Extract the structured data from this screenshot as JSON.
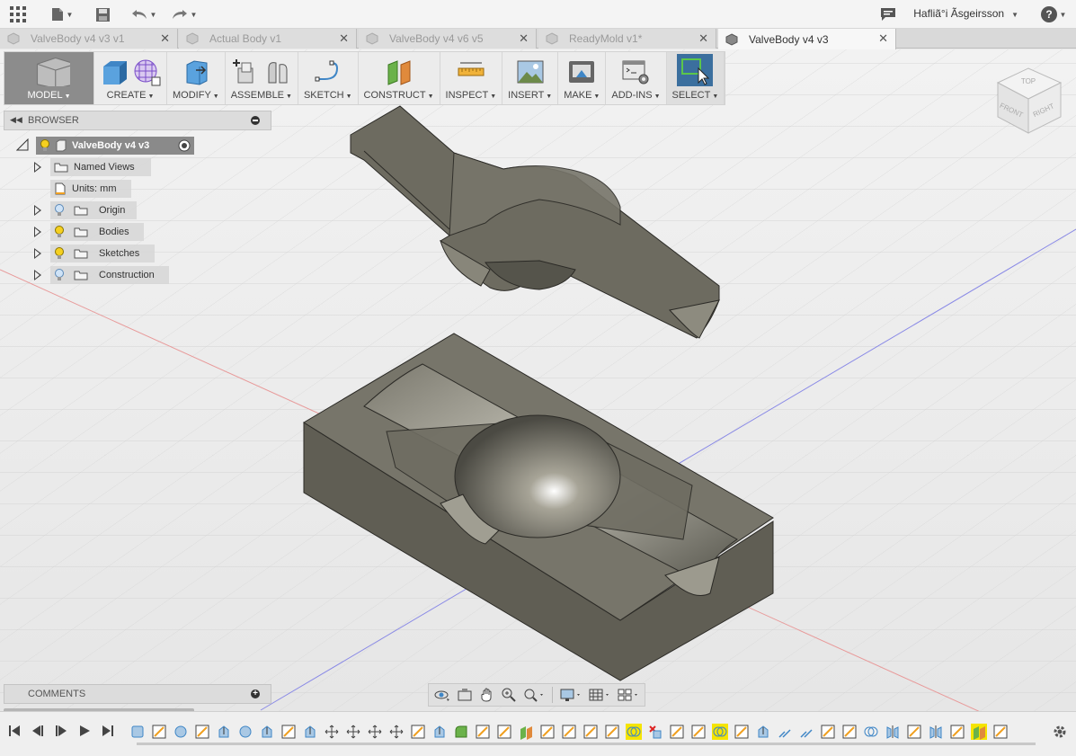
{
  "app": {
    "user_name": "Hafliã°i Ãsgeirsson",
    "icons": [
      "apps-grid-icon",
      "file-icon",
      "save-icon",
      "undo-icon",
      "redo-icon",
      "comment-icon",
      "help-icon"
    ]
  },
  "tabs": [
    {
      "label": "ValveBody v4 v3 v1",
      "active": false
    },
    {
      "label": "Actual Body v1",
      "active": false
    },
    {
      "label": "ValveBody v4 v6 v5",
      "active": false
    },
    {
      "label": "ReadyMold v1*",
      "active": false
    },
    {
      "label": "ValveBody v4 v3",
      "active": true
    }
  ],
  "toolbar": {
    "groups": [
      {
        "label": "MODEL",
        "icons": [
          "model-workspace-icon"
        ]
      },
      {
        "label": "CREATE",
        "icons": [
          "box-icon",
          "form-icon"
        ]
      },
      {
        "label": "MODIFY",
        "icons": [
          "press-pull-icon"
        ]
      },
      {
        "label": "ASSEMBLE",
        "icons": [
          "new-component-icon",
          "joint-icon"
        ]
      },
      {
        "label": "SKETCH",
        "icons": [
          "sketch-icon"
        ]
      },
      {
        "label": "CONSTRUCT",
        "icons": [
          "plane-icon"
        ]
      },
      {
        "label": "INSPECT",
        "icons": [
          "measure-icon"
        ]
      },
      {
        "label": "INSERT",
        "icons": [
          "insert-image-icon"
        ]
      },
      {
        "label": "MAKE",
        "icons": [
          "make-3d-print-icon"
        ]
      },
      {
        "label": "ADD-INS",
        "icons": [
          "scripts-icon"
        ]
      },
      {
        "label": "SELECT",
        "icons": [
          "select-icon"
        ]
      }
    ]
  },
  "browser": {
    "title": "BROWSER",
    "root": "ValveBody v4 v3",
    "items": [
      {
        "label": "Named Views"
      },
      {
        "label": "Units: mm"
      },
      {
        "label": "Origin"
      },
      {
        "label": "Bodies"
      },
      {
        "label": "Sketches"
      },
      {
        "label": "Construction"
      }
    ]
  },
  "comments": {
    "title": "COMMENTS"
  },
  "viewcube": {
    "top": "TOP",
    "front": "FRONT",
    "right": "RIGHT"
  },
  "timeline": {
    "features": [
      "body",
      "sketch",
      "sphere",
      "sketch",
      "extrude",
      "sphere",
      "extrude",
      "sketch",
      "extrude",
      "move",
      "move",
      "move",
      "move",
      "sketch",
      "extrude",
      "fillet",
      "sketch",
      "sketch",
      "construct",
      "sketch",
      "sketch",
      "sketch",
      "sketch",
      "combine",
      "delete",
      "sketch",
      "sketch",
      "combine",
      "sketch",
      "extrude",
      "offset",
      "offset",
      "sketch",
      "sketch",
      "combine",
      "mirror",
      "sketch",
      "mirror",
      "sketch",
      "construct",
      "sketch"
    ]
  }
}
